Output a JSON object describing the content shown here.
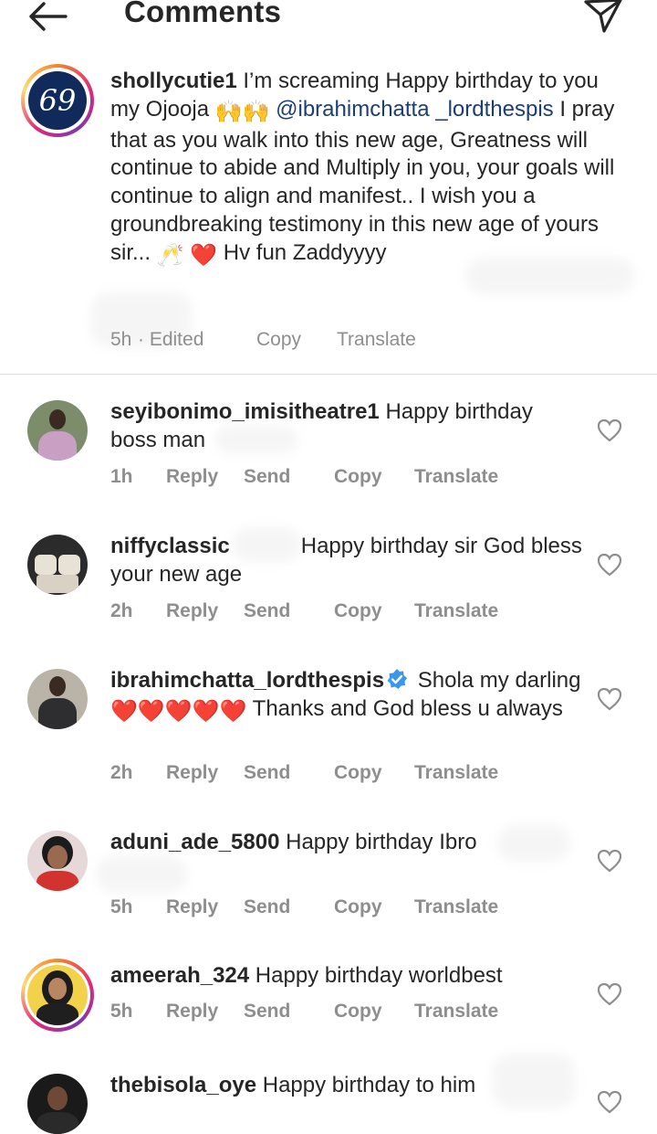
{
  "header": {
    "title": "Comments"
  },
  "caption": {
    "username": "shollycutie1",
    "avatar_text": "69",
    "text_1": " I’m screaming Happy birthday to you my Ojooja ",
    "emoji_1": "🙌🙌",
    "mention": "@ibrahimchatta _lordthespis",
    "text_2": "  I pray that as you walk into this new age, Greatness will continue to abide and Multiply in you, your goals will continue to align and manifest.. I wish you a groundbreaking testimony in this new age of yours sir... ",
    "emoji_2": "🥂 ❤️",
    "text_3": " Hv fun Zaddyyyy",
    "time": "5h",
    "edited": "· Edited",
    "copy": "Copy",
    "translate": "Translate"
  },
  "comments": [
    {
      "username": "seyibonimo_imisitheatre1",
      "text": " Happy birthday boss man",
      "time": "1h",
      "reply": "Reply",
      "send": "Send",
      "copy": "Copy",
      "translate": "Translate"
    },
    {
      "username": "niffyclassic",
      "text": "Happy birthday sir God bless your new age",
      "time": "2h",
      "reply": "Reply",
      "send": "Send",
      "copy": "Copy",
      "translate": "Translate"
    },
    {
      "username": "ibrahimchatta_lordthespis",
      "text_1": " Shola my darling ",
      "emoji": "❤️❤️❤️❤️❤️",
      "text_2": " Thanks and God bless u always",
      "time": "2h",
      "reply": "Reply",
      "send": "Send",
      "copy": "Copy",
      "translate": "Translate"
    },
    {
      "username": "aduni_ade_5800",
      "text": " Happy birthday Ibro",
      "time": "5h",
      "reply": "Reply",
      "send": "Send",
      "copy": "Copy",
      "translate": "Translate"
    },
    {
      "username": "ameerah_324",
      "text": " Happy birthday worldbest",
      "time": "5h",
      "reply": "Reply",
      "send": "Send",
      "copy": "Copy",
      "translate": "Translate"
    },
    {
      "username": "thebisola_oye",
      "text": " Happy birthday to him"
    }
  ],
  "colors": {
    "text": "#262626",
    "meta": "#8e8e8e",
    "mention": "#1c3d7a",
    "verified": "#3897f0",
    "heart_red": "#ed4956"
  }
}
